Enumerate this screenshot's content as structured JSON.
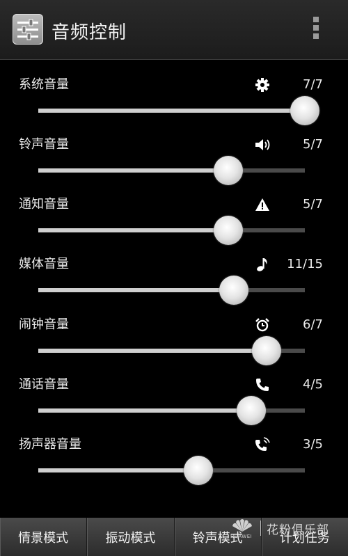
{
  "app_bar": {
    "title": "音频控制",
    "icon": "mixer-icon",
    "menu_icon": "overflow-menu-icon"
  },
  "volumes": [
    {
      "label": "系统音量",
      "icon": "gear-icon",
      "value_text": "7/7",
      "level": 1.0
    },
    {
      "label": "铃声音量",
      "icon": "speaker-icon",
      "value_text": "5/7",
      "level": 0.714
    },
    {
      "label": "通知音量",
      "icon": "warning-icon",
      "value_text": "5/7",
      "level": 0.714
    },
    {
      "label": "媒体音量",
      "icon": "music-note-icon",
      "value_text": "11/15",
      "level": 0.733
    },
    {
      "label": "闹钟音量",
      "icon": "alarm-clock-icon",
      "value_text": "6/7",
      "level": 0.857
    },
    {
      "label": "通话音量",
      "icon": "phone-icon",
      "value_text": "4/5",
      "level": 0.8
    },
    {
      "label": "扬声器音量",
      "icon": "speakerphone-icon",
      "value_text": "3/5",
      "level": 0.6
    }
  ],
  "bottom_bar": {
    "buttons": [
      "情景模式",
      "振动模式",
      "铃声模式",
      "计划任务"
    ]
  },
  "watermark": {
    "brand": "HUAWEI",
    "text": "花粉俱乐部"
  },
  "colors": {
    "background": "#000000",
    "track": "#4a4a4a",
    "fill": "#cfcfcf",
    "text": "#eaeaea"
  }
}
